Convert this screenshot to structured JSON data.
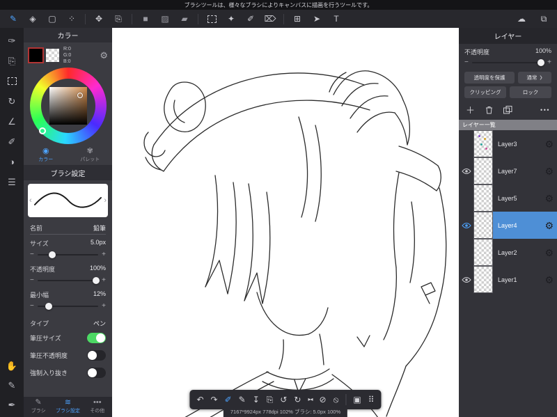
{
  "tooltip_bar": {
    "text": "ブラシツールは、様々なブラシによりキャンバスに描画を行うツールです。"
  },
  "toolbar": {
    "text_tool_label": "T"
  },
  "color_panel": {
    "title": "カラー",
    "rgb_lines": [
      "R:0",
      "G:0",
      "B:0"
    ],
    "tabs": [
      {
        "label": "カラー"
      },
      {
        "label": "パレット"
      }
    ]
  },
  "brush_panel": {
    "title": "ブラシ設定",
    "rows": [
      {
        "label": "名前",
        "value": "鉛筆"
      },
      {
        "label": "サイズ",
        "value": "5.0px"
      },
      {
        "label": "不透明度",
        "value": "100%"
      },
      {
        "label": "最小幅",
        "value": "12%"
      },
      {
        "label": "タイプ",
        "value": "ペン"
      }
    ],
    "toggles": [
      {
        "label": "筆圧サイズ",
        "on": true
      },
      {
        "label": "筆圧不透明度",
        "on": false
      },
      {
        "label": "強制入り抜き",
        "on": false
      }
    ],
    "bottom_tabs": [
      {
        "label": "ブラシ"
      },
      {
        "label": "ブラシ設定"
      },
      {
        "label": "その他"
      }
    ]
  },
  "layer_panel": {
    "title": "レイヤー",
    "opacity_label": "不透明度",
    "opacity_value": "100%",
    "buttons": {
      "protect": "透明度を保護",
      "blend": "通常",
      "clipping": "クリッピング",
      "lock": "ロック"
    },
    "list_header": "レイヤー一覧",
    "layers": [
      {
        "name": "Layer3",
        "visible": false,
        "selected": false
      },
      {
        "name": "Layer7",
        "visible": true,
        "selected": false
      },
      {
        "name": "Layer5",
        "visible": false,
        "selected": false
      },
      {
        "name": "Layer4",
        "visible": true,
        "selected": true
      },
      {
        "name": "Layer2",
        "visible": false,
        "selected": false
      },
      {
        "name": "Layer1",
        "visible": true,
        "selected": false
      }
    ]
  },
  "status_bar": {
    "text": "7167*9924px 778dpi 102% ブラシ: 5.0px 100%"
  },
  "colors": {
    "accent": "#4da3ff",
    "toggle_on": "#4cd964",
    "selected_layer": "#4e8fd6"
  }
}
